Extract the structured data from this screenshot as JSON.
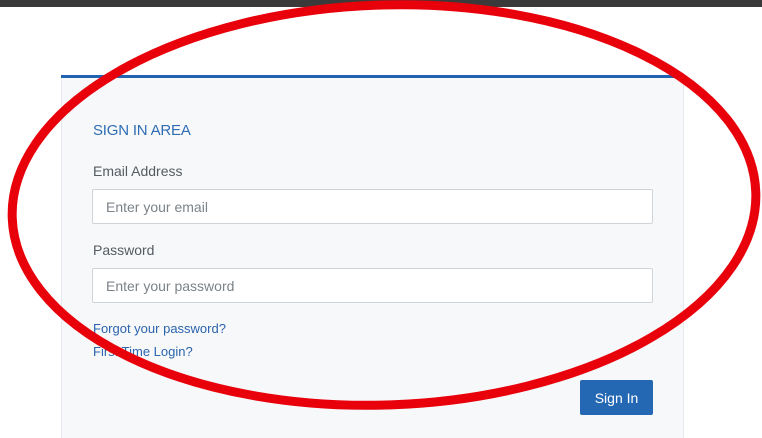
{
  "form": {
    "title": "SIGN IN AREA",
    "email_label": "Email Address",
    "email_placeholder": "Enter your email",
    "email_value": "",
    "password_label": "Password",
    "password_placeholder": "Enter your password",
    "password_value": "",
    "forgot_link": "Forgot your password?",
    "first_login_link": "First Time Login?",
    "signin_button": "Sign In"
  },
  "colors": {
    "accent": "#2163b3",
    "button": "#2468b4",
    "annotation": "#e8000b"
  }
}
